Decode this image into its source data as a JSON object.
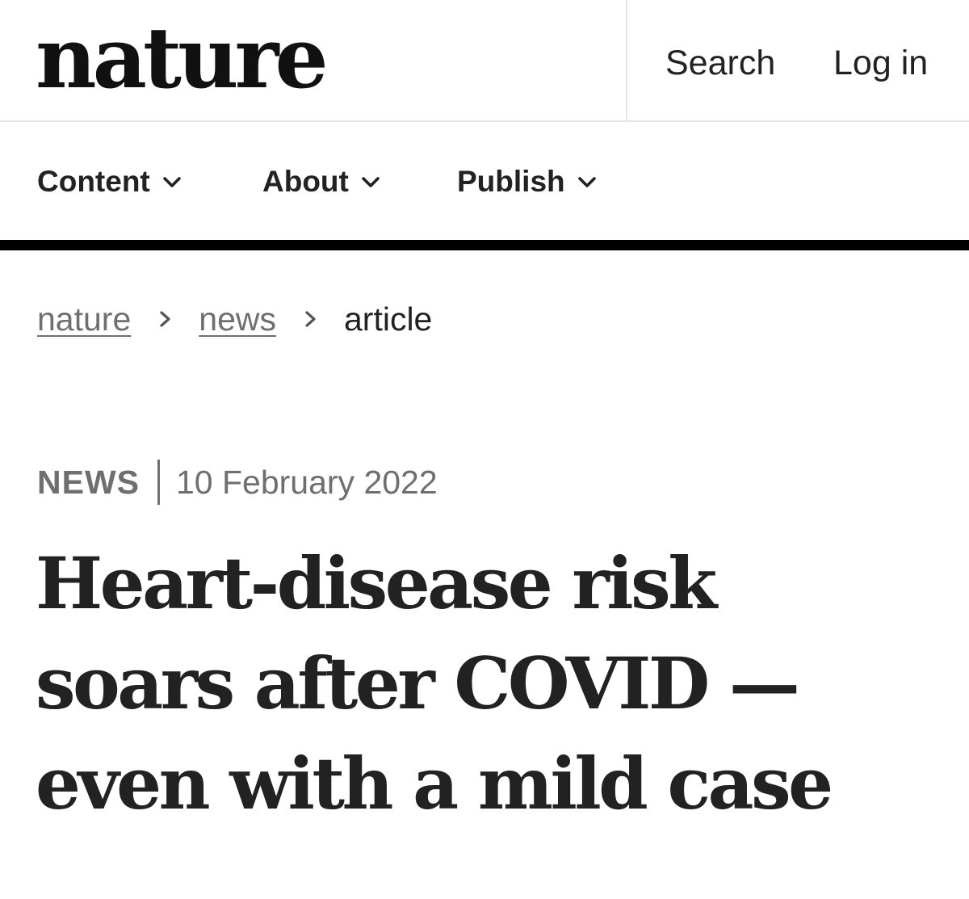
{
  "header": {
    "logo": "nature",
    "search_label": "Search",
    "login_label": "Log in"
  },
  "nav": {
    "items": [
      {
        "label": "Content",
        "icon": "chevron-down-icon"
      },
      {
        "label": "About",
        "icon": "chevron-down-icon"
      },
      {
        "label": "Publish",
        "icon": "chevron-down-icon"
      }
    ]
  },
  "breadcrumb": {
    "items": [
      {
        "label": "nature"
      },
      {
        "label": "news"
      },
      {
        "label": "article"
      }
    ],
    "separator_icon": "chevron-right-icon"
  },
  "article": {
    "type": "NEWS",
    "date": "10 February 2022",
    "title_lines": [
      "Heart-disease risk",
      "soars after COVID —",
      "even with a mild case"
    ]
  },
  "colors": {
    "text": "#222222",
    "muted": "#6f6f6f",
    "rule": "#000000",
    "divider": "#e6e6e6"
  }
}
